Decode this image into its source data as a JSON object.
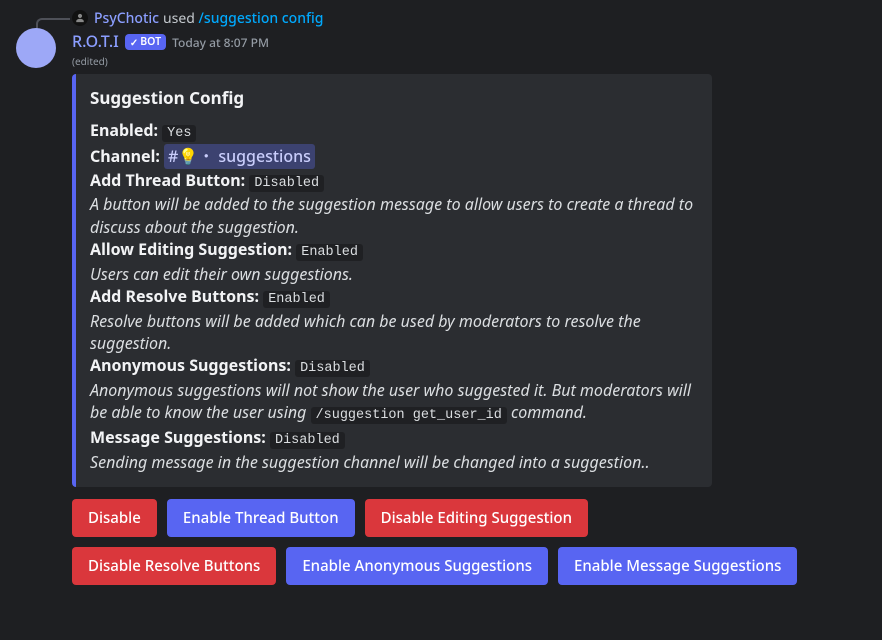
{
  "reply": {
    "username": "PsyChotic",
    "verb": "used",
    "command": "/suggestion config"
  },
  "bot": {
    "name": "R.O.T.I",
    "badge": "BOT"
  },
  "timestamp": "Today at 8:07 PM",
  "edited": "(edited)",
  "embed": {
    "title": "Suggestion Config",
    "enabled_label": "Enabled:",
    "enabled_value": "Yes",
    "channel_label": "Channel:",
    "channel_name_prefix": "#💡・",
    "channel_name": "suggestions",
    "thread_label": "Add Thread Button:",
    "thread_value": "Disabled",
    "thread_desc": "A button will be added to the suggestion message to allow users to create a thread to discuss about the suggestion.",
    "edit_label": "Allow Editing Suggestion:",
    "edit_value": "Enabled",
    "edit_desc": "Users can edit their own suggestions.",
    "resolve_label": "Add Resolve Buttons:",
    "resolve_value": "Enabled",
    "resolve_desc": "Resolve buttons will be added which can be used by moderators to resolve the suggestion.",
    "anon_label": "Anonymous Suggestions:",
    "anon_value": "Disabled",
    "anon_desc_a": "Anonymous suggestions will not show the user who suggested it. But moderators will be able to know the user using ",
    "anon_cmd": "/suggestion get_user_id",
    "anon_desc_b": " command.",
    "msg_label": "Message Suggestions:",
    "msg_value": "Disabled",
    "msg_desc": "Sending message in the suggestion channel will be changed into a suggestion.."
  },
  "buttons": {
    "disable": "Disable",
    "thread": "Enable Thread Button",
    "edit": "Disable Editing Suggestion",
    "resolve": "Disable Resolve Buttons",
    "anon": "Enable Anonymous Suggestions",
    "msg": "Enable Message Suggestions"
  }
}
